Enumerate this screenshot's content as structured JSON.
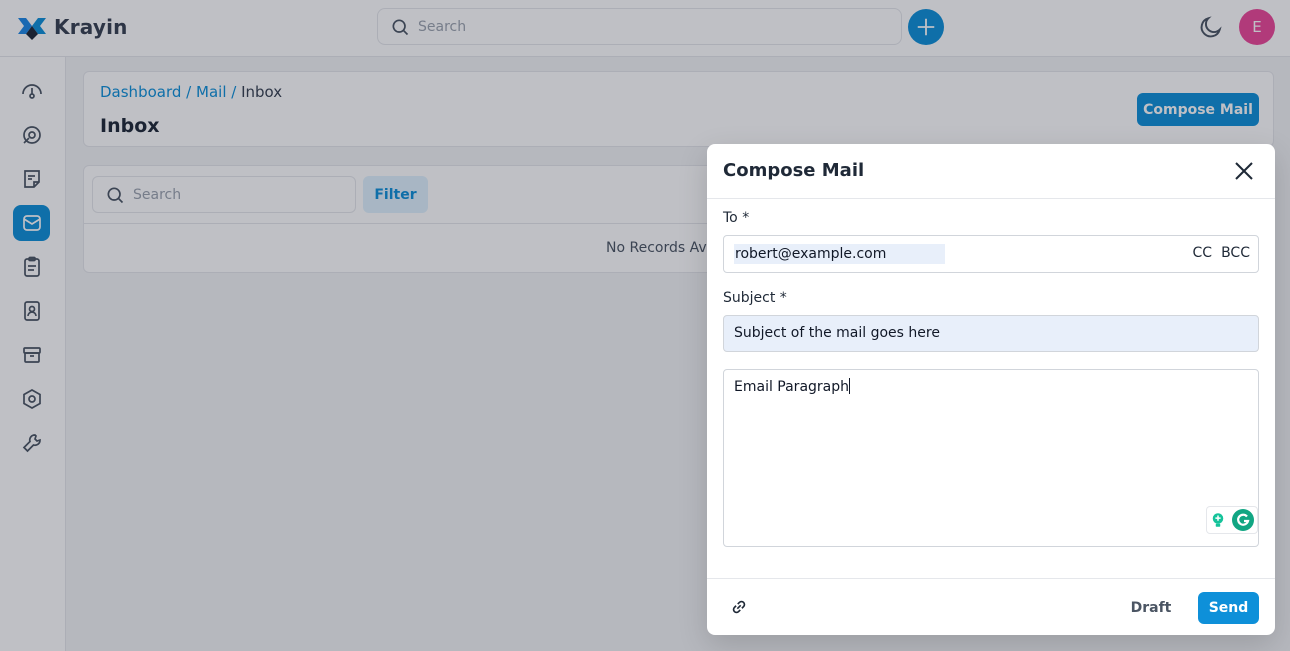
{
  "app": {
    "name": "Krayin"
  },
  "search": {
    "placeholder": "Search"
  },
  "user": {
    "initial": "E"
  },
  "sidebar": {
    "items": [
      {
        "icon": "dashboard-icon"
      },
      {
        "icon": "leads-icon"
      },
      {
        "icon": "quotes-icon"
      },
      {
        "icon": "mail-icon",
        "active": true
      },
      {
        "icon": "activities-icon"
      },
      {
        "icon": "contacts-icon"
      },
      {
        "icon": "products-icon"
      },
      {
        "icon": "settings-icon"
      },
      {
        "icon": "configuration-icon"
      }
    ]
  },
  "header": {
    "breadcrumb": {
      "dashboard": "Dashboard",
      "mail": "Mail",
      "current": "Inbox",
      "separator": "/"
    },
    "title": "Inbox",
    "compose_button": "Compose Mail"
  },
  "list": {
    "search_placeholder": "Search",
    "filter_button": "Filter",
    "empty_text": "No Records Ava"
  },
  "modal": {
    "title": "Compose Mail",
    "to_label": "To *",
    "to_value": "robert@example.com",
    "cc_label": "CC",
    "bcc_label": "BCC",
    "subject_label": "Subject *",
    "subject_value": "Subject of the mail goes here",
    "body_value": "Email Paragraph",
    "draft_button": "Draft",
    "send_button": "Send"
  },
  "colors": {
    "accent": "#0e90d9",
    "avatar": "#ec4899",
    "overlay": "rgba(17,24,39,0.27)"
  }
}
